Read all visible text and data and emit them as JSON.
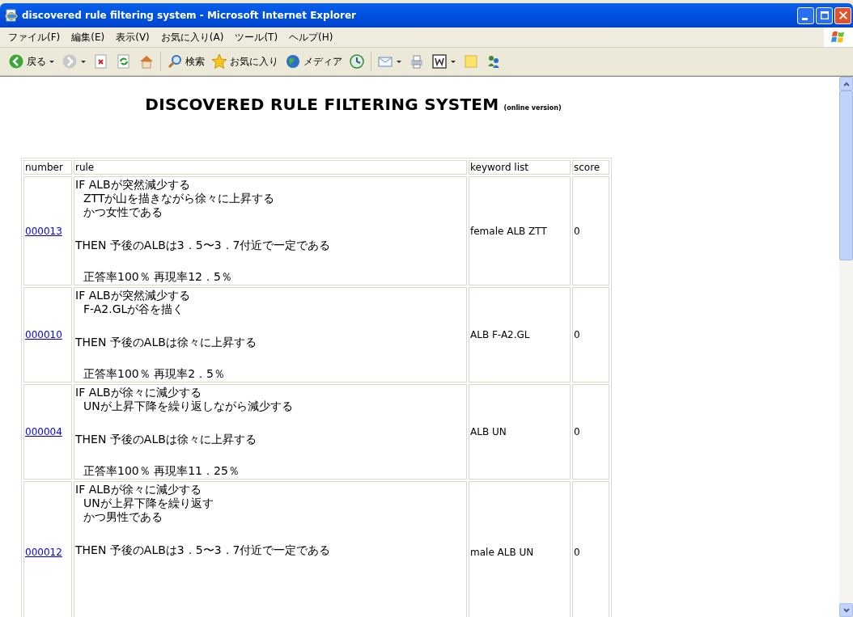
{
  "window": {
    "title": "discovered rule filtering system - Microsoft Internet Explorer"
  },
  "menu": [
    "ファイル(F)",
    "編集(E)",
    "表示(V)",
    "お気に入り(A)",
    "ツール(T)",
    "ヘルプ(H)"
  ],
  "toolbar": [
    {
      "kind": "back",
      "label": "戻る",
      "dropdown": true
    },
    {
      "kind": "forward",
      "dropdown": true
    },
    {
      "kind": "stop"
    },
    {
      "kind": "refresh"
    },
    {
      "kind": "home"
    },
    {
      "kind": "separator"
    },
    {
      "kind": "search",
      "label": "検索"
    },
    {
      "kind": "favorites",
      "label": "お気に入り"
    },
    {
      "kind": "media",
      "label": "メディア"
    },
    {
      "kind": "history"
    },
    {
      "kind": "separator"
    },
    {
      "kind": "mail",
      "dropdown": true
    },
    {
      "kind": "print"
    },
    {
      "kind": "edit",
      "dropdown": true
    },
    {
      "kind": "note"
    },
    {
      "kind": "messenger"
    }
  ],
  "page": {
    "title": "DISCOVERED RULE FILTERING SYSTEM",
    "subtitle": "(online version)"
  },
  "table": {
    "columns": [
      "number",
      "rule",
      "keyword list",
      "score"
    ],
    "rows": [
      {
        "number": "000013",
        "keywords": "female ALB ZTT",
        "score": "0",
        "lines": [
          {
            "kind": "if",
            "text": "IF  ALBが突然減少する"
          },
          {
            "kind": "cond",
            "text": "ZTTが山を描きながら徐々に上昇する"
          },
          {
            "kind": "cond",
            "text": "かつ女性である"
          },
          {
            "kind": "then",
            "text": "THEN  予後のALBは3．5〜3．7付近で一定である"
          },
          {
            "kind": "stats",
            "text": "正答率100％  再現率12．5％"
          }
        ]
      },
      {
        "number": "000010",
        "keywords": "ALB F-A2.GL",
        "score": "0",
        "lines": [
          {
            "kind": "if",
            "text": "IF  ALBが突然減少する"
          },
          {
            "kind": "cond",
            "text": "F-A2.GLが谷を描く"
          },
          {
            "kind": "then",
            "text": "THEN  予後のALBは徐々に上昇する"
          },
          {
            "kind": "stats",
            "text": "正答率100％  再現率2．5％"
          }
        ]
      },
      {
        "number": "000004",
        "keywords": "ALB UN",
        "score": "0",
        "lines": [
          {
            "kind": "if",
            "text": "IF  ALBが徐々に減少する"
          },
          {
            "kind": "cond",
            "text": "UNが上昇下降を繰り返しながら減少する"
          },
          {
            "kind": "then",
            "text": "THEN  予後のALBは徐々に上昇する"
          },
          {
            "kind": "stats",
            "text": "正答率100％  再現率11．25％"
          }
        ]
      },
      {
        "number": "000012",
        "keywords": "male ALB UN",
        "score": "0",
        "lines": [
          {
            "kind": "if",
            "text": "IF  ALBが徐々に減少する"
          },
          {
            "kind": "cond",
            "text": "UNが上昇下降を繰り返す"
          },
          {
            "kind": "cond",
            "text": "かつ男性である"
          },
          {
            "kind": "then",
            "text": "THEN  予後のALBは3．5〜3．7付近で一定である"
          }
        ]
      }
    ]
  }
}
